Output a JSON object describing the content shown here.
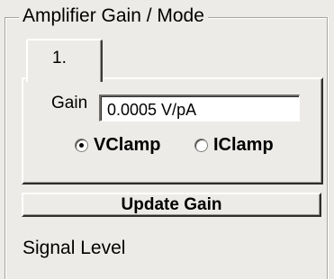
{
  "amplifier_group": {
    "title": "Amplifier Gain / Mode",
    "tabs": [
      {
        "label": "1.",
        "selected": true
      }
    ],
    "gain": {
      "label": "Gain",
      "value": "0.0005 V/pA"
    },
    "mode": {
      "options": [
        {
          "label": "VClamp",
          "selected": true
        },
        {
          "label": "IClamp",
          "selected": false
        }
      ]
    },
    "update_button_label": "Update Gain"
  },
  "next_group": {
    "title": "Signal Level"
  }
}
